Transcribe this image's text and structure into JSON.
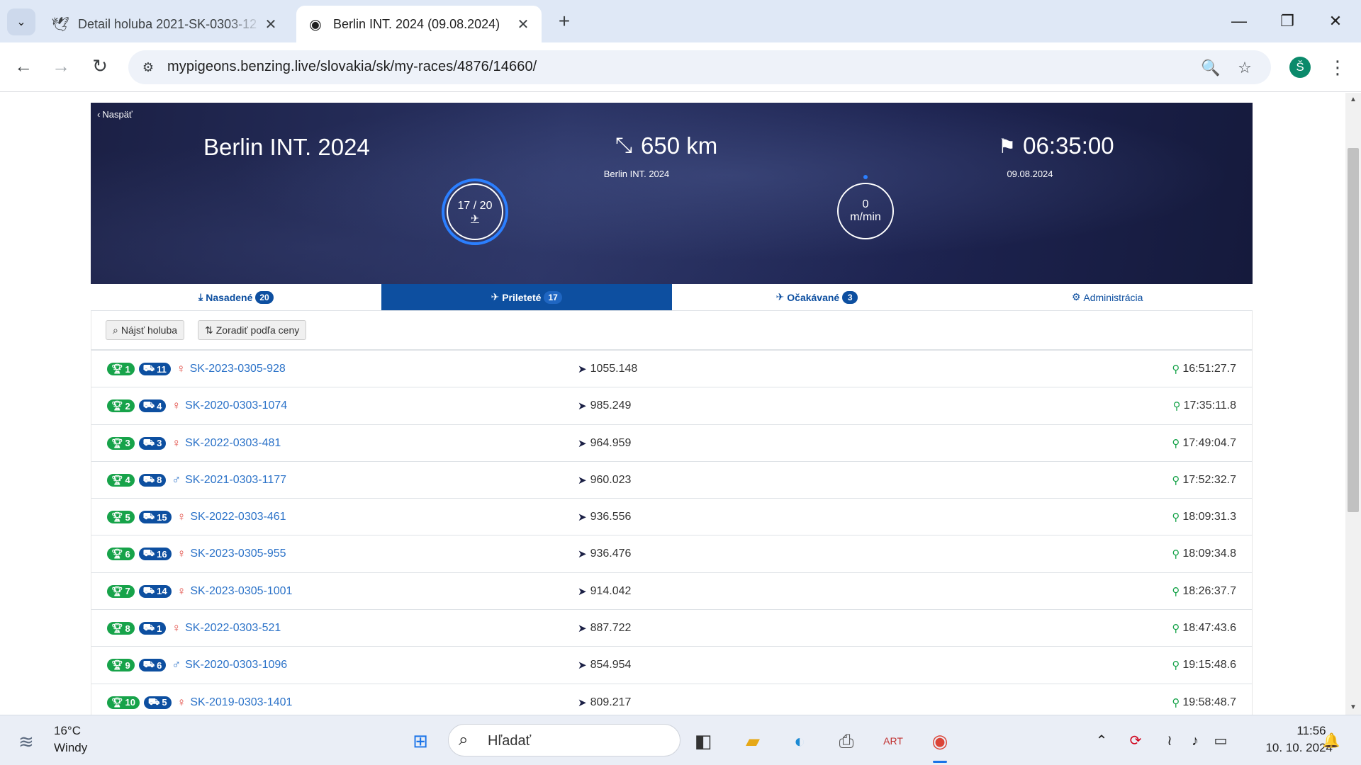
{
  "browser": {
    "tabs": [
      {
        "title": "Detail holuba 2021-SK-0303-12",
        "favicon": "pigeon-icon"
      },
      {
        "title": "Berlin INT. 2024 (09.08.2024)",
        "favicon": "benzing-icon"
      }
    ],
    "url": "mypigeons.benzing.live/slovakia/sk/my-races/4876/14660/",
    "avatar_letter": "Š"
  },
  "race": {
    "back_label": "Naspäť",
    "title": "Berlin INT. 2024",
    "distance": "650 km",
    "distance_sub": "Berlin INT. 2024",
    "flight_time": "06:35:00",
    "date": "09.08.2024",
    "arrived_ratio": "17 / 20",
    "speed_value": "0",
    "speed_unit": "m/min"
  },
  "tabs": [
    {
      "label": "Nasadené",
      "count": "20"
    },
    {
      "label": "Prileteté",
      "count": "17"
    },
    {
      "label": "Očakávané",
      "count": "3"
    },
    {
      "label": "Administrácia"
    }
  ],
  "filters": {
    "find_label": "Nájsť holuba",
    "sort_label": "Zoradiť podľa ceny"
  },
  "results": [
    {
      "rank": "1",
      "basket": "11",
      "sex": "♀",
      "ring": "SK-2023-0305-928",
      "speed": "1055.148",
      "time": "16:51:27.7"
    },
    {
      "rank": "2",
      "basket": "4",
      "sex": "♀",
      "ring": "SK-2020-0303-1074",
      "speed": "985.249",
      "time": "17:35:11.8"
    },
    {
      "rank": "3",
      "basket": "3",
      "sex": "♀",
      "ring": "SK-2022-0303-481",
      "speed": "964.959",
      "time": "17:49:04.7"
    },
    {
      "rank": "4",
      "basket": "8",
      "sex": "♂",
      "ring": "SK-2021-0303-1177",
      "speed": "960.023",
      "time": "17:52:32.7"
    },
    {
      "rank": "5",
      "basket": "15",
      "sex": "♀",
      "ring": "SK-2022-0303-461",
      "speed": "936.556",
      "time": "18:09:31.3"
    },
    {
      "rank": "6",
      "basket": "16",
      "sex": "♀",
      "ring": "SK-2023-0305-955",
      "speed": "936.476",
      "time": "18:09:34.8"
    },
    {
      "rank": "7",
      "basket": "14",
      "sex": "♀",
      "ring": "SK-2023-0305-1001",
      "speed": "914.042",
      "time": "18:26:37.7"
    },
    {
      "rank": "8",
      "basket": "1",
      "sex": "♀",
      "ring": "SK-2022-0303-521",
      "speed": "887.722",
      "time": "18:47:43.6"
    },
    {
      "rank": "9",
      "basket": "6",
      "sex": "♂",
      "ring": "SK-2020-0303-1096",
      "speed": "854.954",
      "time": "19:15:48.6"
    },
    {
      "rank": "10",
      "basket": "5",
      "sex": "♀",
      "ring": "SK-2019-0303-1401",
      "speed": "809.217",
      "time": "19:58:48.7"
    }
  ],
  "taskbar": {
    "temperature": "16°C",
    "weather": "Windy",
    "search_placeholder": "Hľadať",
    "time": "11:56",
    "date": "10. 10. 2024"
  }
}
